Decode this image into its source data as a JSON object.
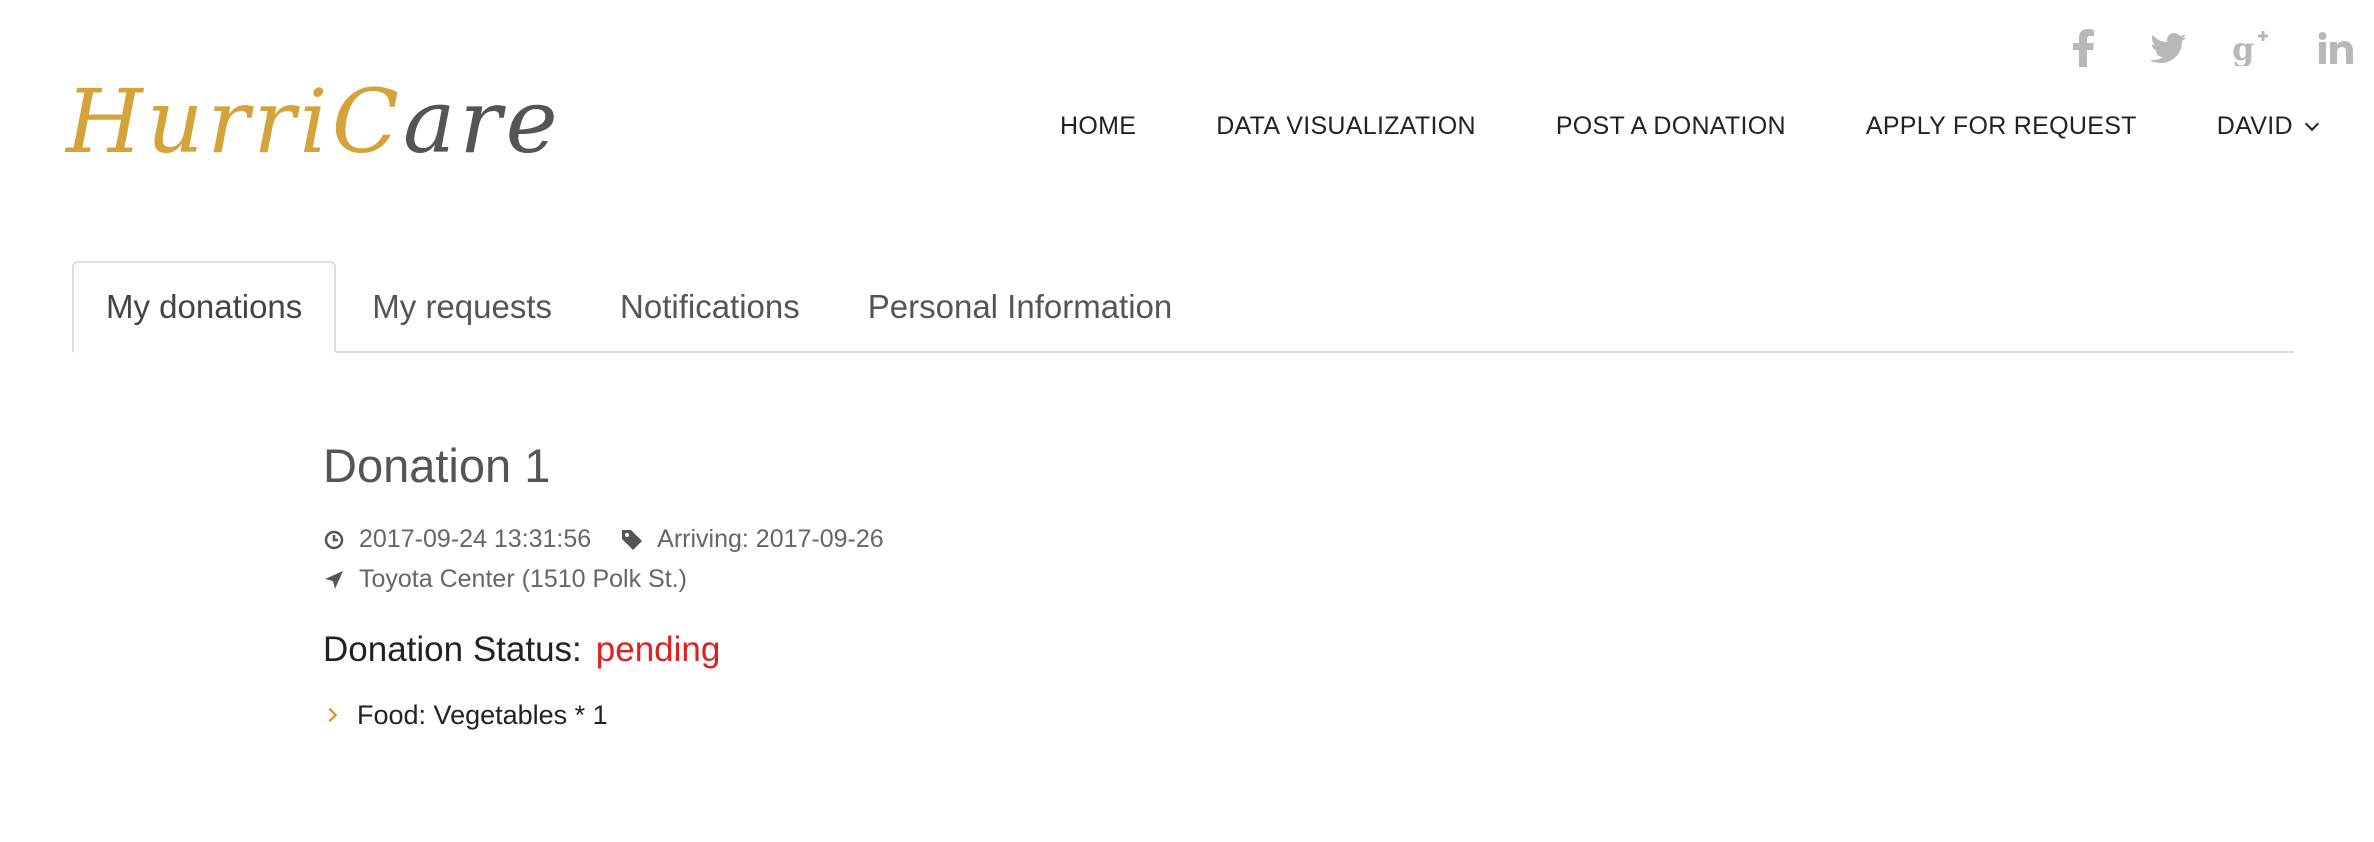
{
  "brand": {
    "logo_part1": "Hurri",
    "logo_part2": "C",
    "logo_part3": "are",
    "primary_color": "#d4a43a",
    "secondary_color": "#555555"
  },
  "social": [
    {
      "icon": "facebook-icon",
      "glyph": "f"
    },
    {
      "icon": "twitter-icon",
      "glyph": "t"
    },
    {
      "icon": "google-plus-icon",
      "glyph": "g+"
    },
    {
      "icon": "linkedin-icon",
      "glyph": "in"
    }
  ],
  "nav": {
    "home": "HOME",
    "data_visualization": "DATA VISUALIZATION",
    "post_donation": "POST A DONATION",
    "apply_request": "APPLY FOR REQUEST",
    "user": "DAVID"
  },
  "tabs": {
    "my_donations": "My donations",
    "my_requests": "My requests",
    "notifications": "Notifications",
    "personal_information": "Personal Information",
    "active": "my_donations"
  },
  "donation": {
    "title": "Donation 1",
    "created_at": "2017-09-24 13:31:56",
    "arriving": "Arriving: 2017-09-26",
    "location": "Toyota Center (1510 Polk St.)",
    "status_label": "Donation Status:",
    "status_value": "pending",
    "status_color": "#e02020",
    "items": [
      {
        "text": "Food: Vegetables * 1"
      }
    ]
  }
}
